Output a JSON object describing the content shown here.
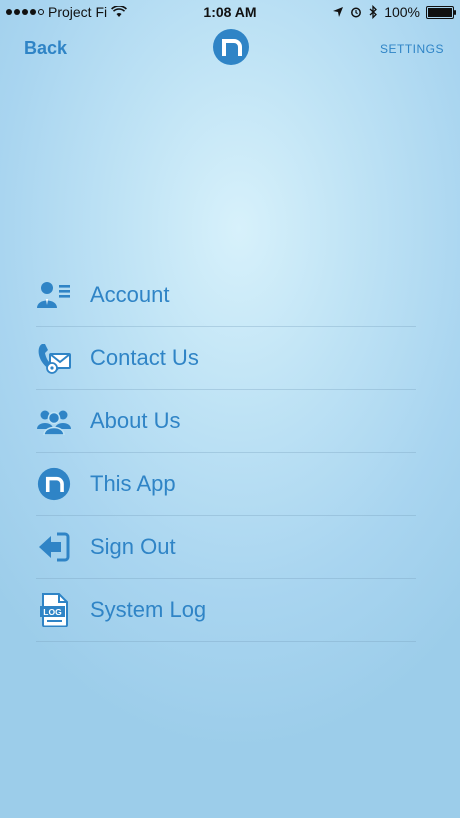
{
  "status_bar": {
    "carrier": "Project Fi",
    "time": "1:08 AM",
    "battery": "100%"
  },
  "nav": {
    "back_label": "Back",
    "settings_label": "SETTINGS"
  },
  "menu": {
    "items": [
      {
        "label": "Account",
        "icon": "account-icon"
      },
      {
        "label": "Contact Us",
        "icon": "contact-icon"
      },
      {
        "label": "About Us",
        "icon": "group-icon"
      },
      {
        "label": "This App",
        "icon": "app-logo-icon"
      },
      {
        "label": "Sign Out",
        "icon": "sign-out-icon"
      },
      {
        "label": "System Log",
        "icon": "log-icon"
      }
    ]
  },
  "colors": {
    "accent": "#2f84c6"
  }
}
